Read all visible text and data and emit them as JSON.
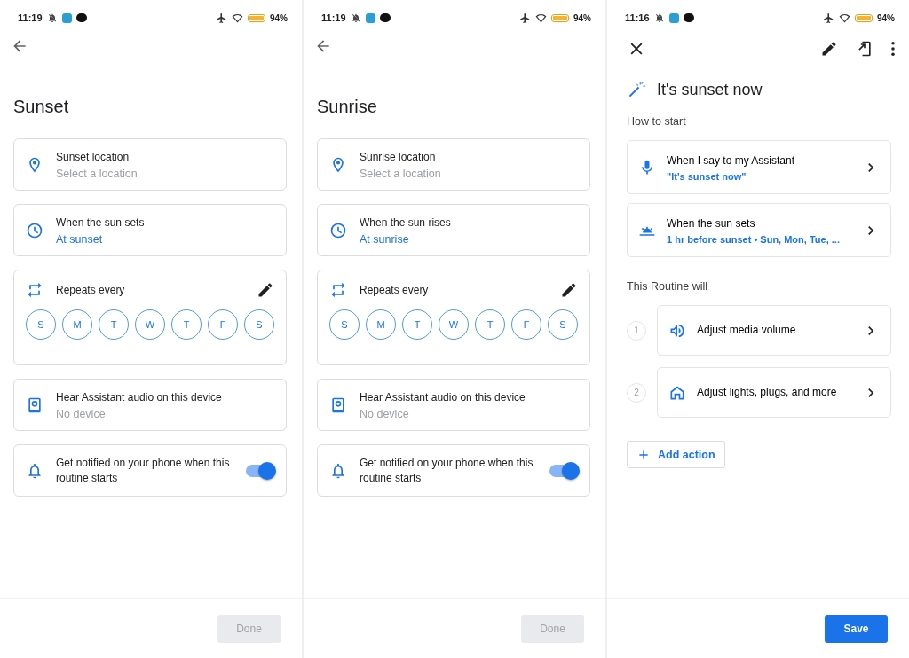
{
  "screens": [
    {
      "kind": "trigger_settings",
      "status_bar": {
        "time": "11:19",
        "battery": "94%"
      },
      "title": "Sunset",
      "cards": [
        {
          "kind": "location",
          "title": "Sunset location",
          "subtitle": "Select a location"
        },
        {
          "kind": "time",
          "title": "When the sun sets",
          "value": "At sunset"
        },
        {
          "kind": "repeat",
          "title": "Repeats every",
          "days": [
            {
              "label": "S",
              "selected": false
            },
            {
              "label": "M",
              "selected": false
            },
            {
              "label": "T",
              "selected": false
            },
            {
              "label": "W",
              "selected": false
            },
            {
              "label": "T",
              "selected": false
            },
            {
              "label": "F",
              "selected": false
            },
            {
              "label": "S",
              "selected": false
            }
          ]
        },
        {
          "kind": "device",
          "title": "Hear Assistant audio on this device",
          "subtitle": "No device"
        },
        {
          "kind": "notify",
          "title": "Get notified on your phone when this routine starts",
          "on": true
        }
      ],
      "button": {
        "label": "Done",
        "disabled": true
      }
    },
    {
      "kind": "trigger_settings",
      "status_bar": {
        "time": "11:19",
        "battery": "94%"
      },
      "title": "Sunrise",
      "cards": [
        {
          "kind": "location",
          "title": "Sunrise location",
          "subtitle": "Select a location"
        },
        {
          "kind": "time",
          "title": "When the sun rises",
          "value": "At sunrise"
        },
        {
          "kind": "repeat",
          "title": "Repeats every",
          "days": [
            {
              "label": "S",
              "selected": false
            },
            {
              "label": "M",
              "selected": false
            },
            {
              "label": "T",
              "selected": false
            },
            {
              "label": "W",
              "selected": false
            },
            {
              "label": "T",
              "selected": false
            },
            {
              "label": "F",
              "selected": false
            },
            {
              "label": "S",
              "selected": false
            }
          ]
        },
        {
          "kind": "device",
          "title": "Hear Assistant audio on this device",
          "subtitle": "No device"
        },
        {
          "kind": "notify",
          "title": "Get notified on your phone when this routine starts",
          "on": true
        }
      ],
      "button": {
        "label": "Done",
        "disabled": true
      }
    },
    {
      "kind": "routine",
      "status_bar": {
        "time": "11:16",
        "battery": "94%"
      },
      "title": "It's sunset now",
      "how_to_start": {
        "heading": "How to start",
        "items": [
          {
            "kind": "voice",
            "title": "When I say to my Assistant",
            "value": "\"It's sunset now\""
          },
          {
            "kind": "sun",
            "title": "When the sun sets",
            "value": "1 hr before sunset • Sun, Mon, Tue, ..."
          }
        ]
      },
      "actions": {
        "heading": "This Routine will",
        "items": [
          {
            "number": "1",
            "kind": "volume",
            "label": "Adjust media volume"
          },
          {
            "number": "2",
            "kind": "home",
            "label": "Adjust lights, plugs, and more"
          }
        ],
        "add_button": "Add action"
      },
      "button": {
        "label": "Save",
        "disabled": false
      }
    }
  ]
}
